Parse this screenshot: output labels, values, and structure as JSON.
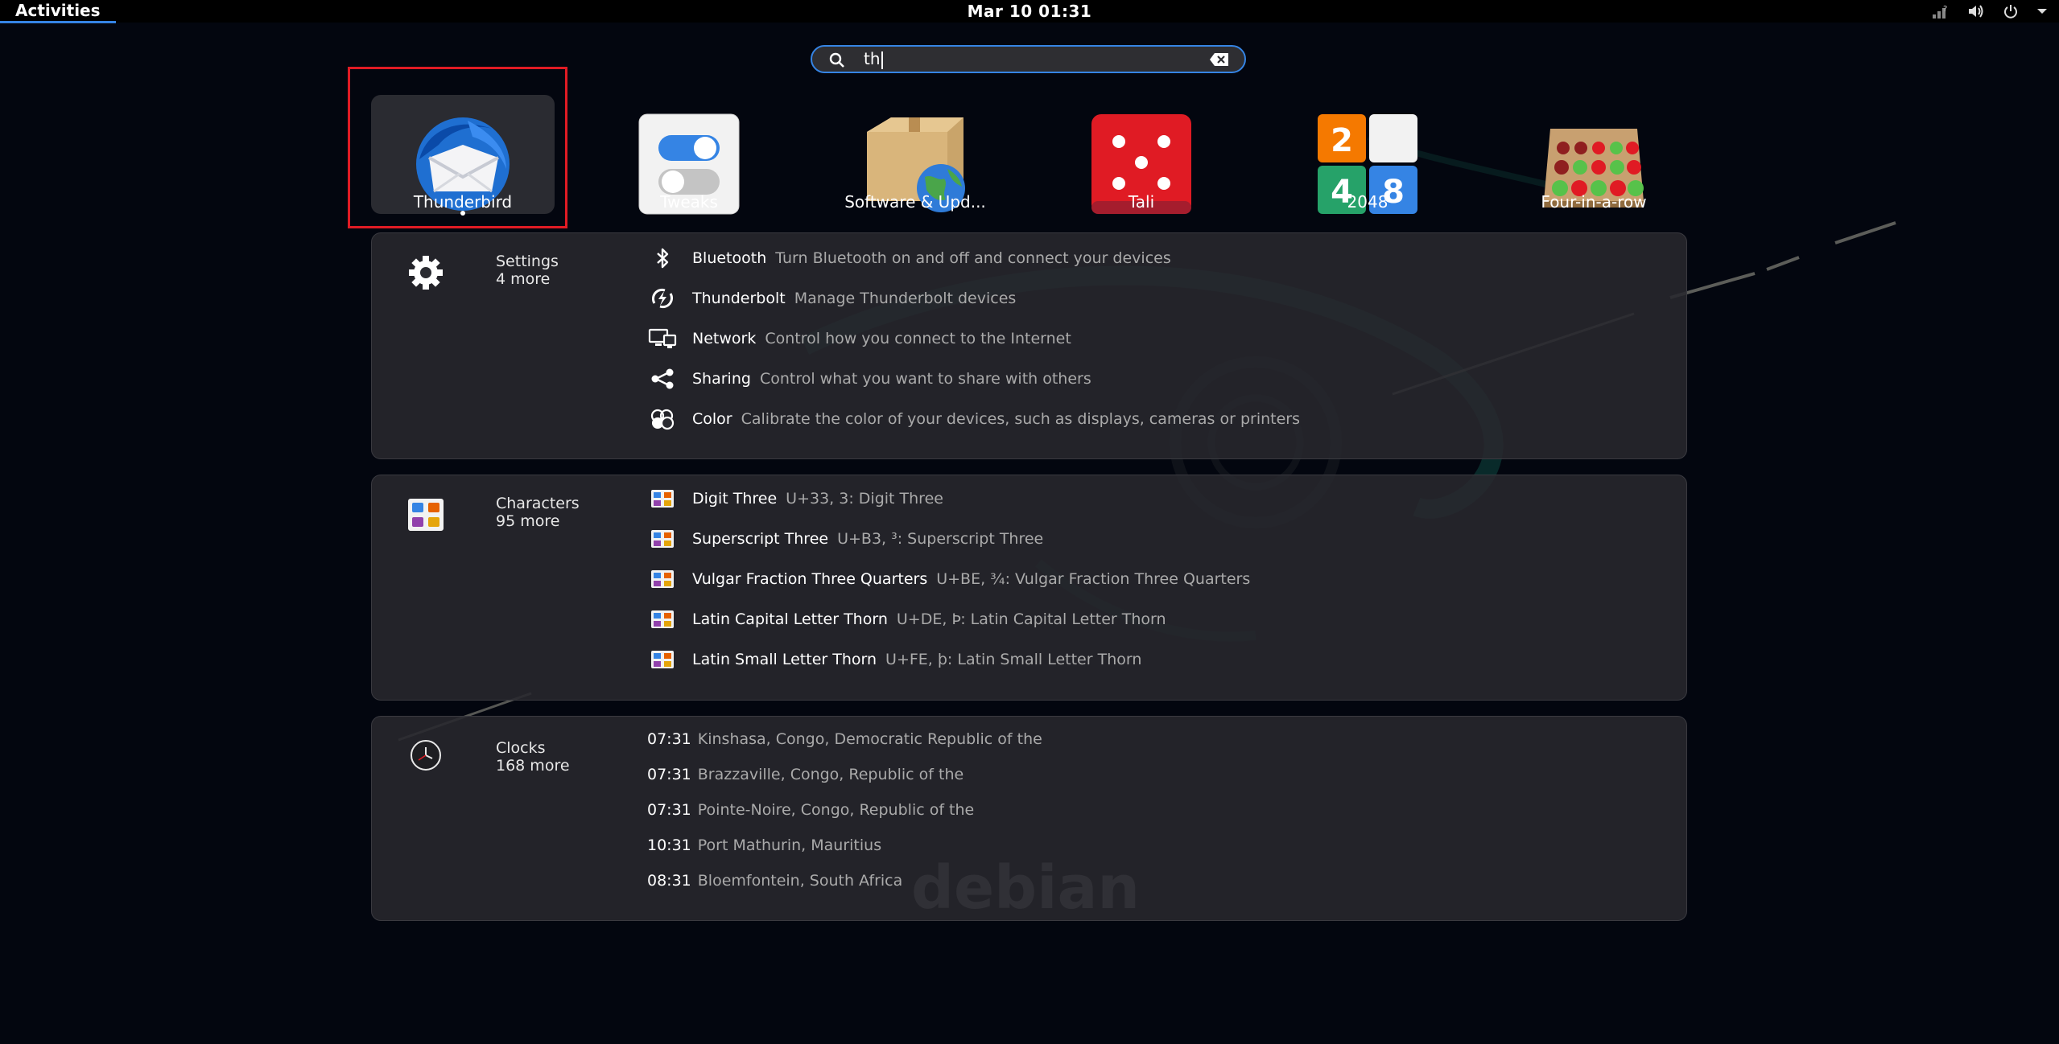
{
  "topbar": {
    "activities": "Activities",
    "clock": "Mar 10  01:31"
  },
  "search": {
    "query": "th"
  },
  "apps": [
    {
      "label": "Thunderbird",
      "icon": "thunderbird-icon"
    },
    {
      "label": "Tweaks",
      "icon": "tweaks-icon"
    },
    {
      "label": "Software & Upd...",
      "icon": "software-update-icon"
    },
    {
      "label": "Tali",
      "icon": "dice-icon"
    },
    {
      "label": "2048",
      "icon": "game-2048-icon"
    },
    {
      "label": "Four-in-a-row",
      "icon": "four-in-a-row-icon"
    }
  ],
  "settings": {
    "name": "Settings",
    "more": "4 more",
    "rows": [
      {
        "title": "Bluetooth",
        "desc": "Turn Bluetooth on and off and connect your devices"
      },
      {
        "title": "Thunderbolt",
        "desc": "Manage Thunderbolt devices"
      },
      {
        "title": "Network",
        "desc": "Control how you connect to the Internet"
      },
      {
        "title": "Sharing",
        "desc": "Control what you want to share with others"
      },
      {
        "title": "Color",
        "desc": "Calibrate the color of your devices, such as displays, cameras or printers"
      }
    ]
  },
  "characters": {
    "name": "Characters",
    "more": "95 more",
    "rows": [
      {
        "title": "Digit Three",
        "desc": "U+33, 3: Digit Three"
      },
      {
        "title": "Superscript Three",
        "desc": "U+B3, ³: Superscript Three"
      },
      {
        "title": "Vulgar Fraction Three Quarters",
        "desc": "U+BE, ¾: Vulgar Fraction Three Quarters"
      },
      {
        "title": "Latin Capital Letter Thorn",
        "desc": "U+DE, Þ: Latin Capital Letter Thorn"
      },
      {
        "title": "Latin Small Letter Thorn",
        "desc": "U+FE, þ: Latin Small Letter Thorn"
      }
    ]
  },
  "clocks": {
    "name": "Clocks",
    "more": "168 more",
    "rows": [
      {
        "time": "07:31",
        "place": "Kinshasa, Congo, Democratic Republic of the"
      },
      {
        "time": "07:31",
        "place": "Brazzaville, Congo, Republic of the"
      },
      {
        "time": "07:31",
        "place": "Pointe-Noire, Congo, Republic of the"
      },
      {
        "time": "10:31",
        "place": "Port Mathurin, Mauritius"
      },
      {
        "time": "08:31",
        "place": "Bloemfontein, South Africa"
      }
    ]
  },
  "wallpaper_text": "debian",
  "colors": {
    "accent": "#3584e4",
    "highlight": "#e01b24",
    "background": "#03060f"
  }
}
